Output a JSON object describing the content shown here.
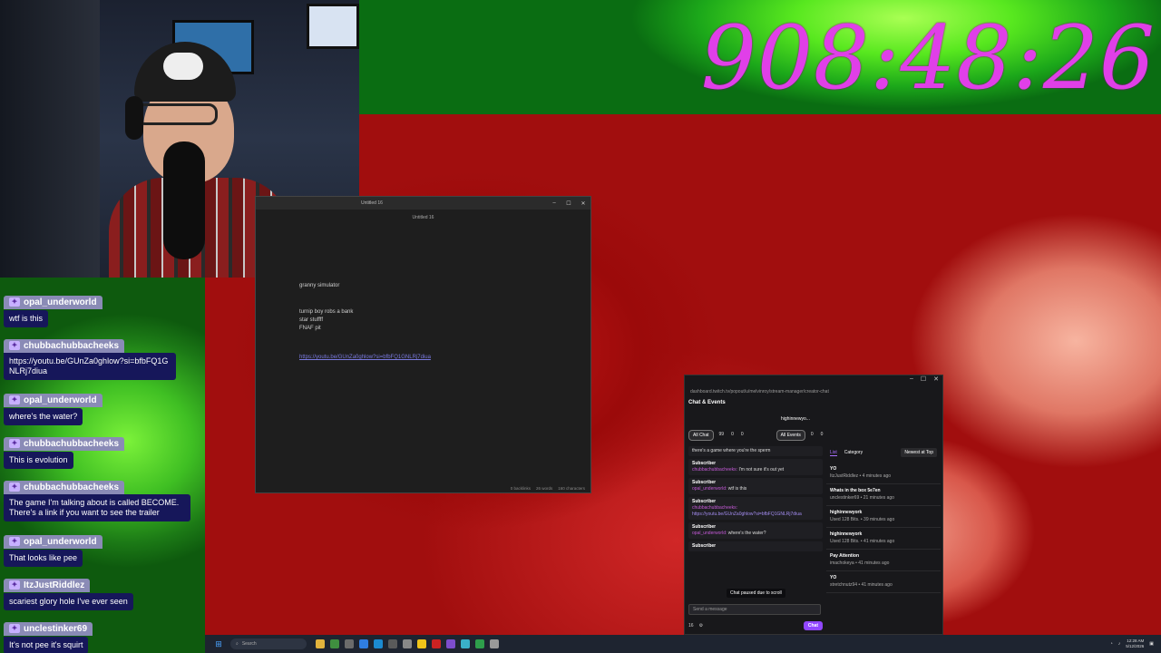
{
  "timer": {
    "text": "908:48:26"
  },
  "chat_overlay": {
    "messages": [
      {
        "user": "opal_underworld",
        "text": "wtf is this"
      },
      {
        "user": "chubbachubbacheeks",
        "text": "https://youtu.be/GUnZa0ghlow?si=bfbFQ1GNLRj7diua"
      },
      {
        "user": "opal_underworld",
        "text": "where's the water?"
      },
      {
        "user": "chubbachubbacheeks",
        "text": "This is evolution"
      },
      {
        "user": "chubbachubbacheeks",
        "text": "The game I'm talking about is called BECOME. There's a link if you want to see the trailer"
      },
      {
        "user": "opal_underworld",
        "text": "That looks like pee"
      },
      {
        "user": "ItzJustRiddlez",
        "text": "scariest glory hole I've ever seen"
      },
      {
        "user": "unclestinker69",
        "text": "It's not pee it's squirt"
      }
    ]
  },
  "notepad": {
    "tab_title": "Untitled 16",
    "doc_title": "Untitled 16",
    "lines": [
      "granny simulator",
      "turnip boy robs a bank",
      "star stuffff",
      "FNAF pit"
    ],
    "link": "https://youtu.be/GUnZa0ghlow?si=bfbFQ1GNLRj7diua",
    "footer": {
      "backlinks": "0 backlinks",
      "words": "26 words",
      "characters": "160 characters"
    }
  },
  "twitch": {
    "url": "dashboard.twitch.tv/popout/u/melvinroy/stream-manager/creator-chat",
    "header": "Chat & Events",
    "channel": "highinnewyo...",
    "tabs": {
      "all_chat": "All Chat",
      "count1": "99",
      "count2": "0",
      "count3": "0",
      "all_events": "All Events",
      "count4": "0",
      "count5": "0"
    },
    "chat": [
      {
        "kind": "partial",
        "text": "there's a game where you're the sperm"
      },
      {
        "kind": "sub",
        "badge": "Subscriber",
        "user": "chubbachubbacheeks:",
        "text": "I'm not sure it's out yet"
      },
      {
        "kind": "sub",
        "badge": "Subscriber",
        "user": "opal_underworld:",
        "text": "wtf is this"
      },
      {
        "kind": "sub",
        "badge": "Subscriber",
        "user": "chubbachubbacheeks:",
        "text": "https://youtu.be/GUnZa0ghlow?si=bfbFQ1GNLRj7diua"
      },
      {
        "kind": "sub",
        "badge": "Subscriber",
        "user": "opal_underworld:",
        "text": "where's the water?"
      },
      {
        "kind": "sub",
        "badge": "Subscriber",
        "user": "",
        "text": ""
      }
    ],
    "paused": "Chat paused due to scroll",
    "input_placeholder": "Send a message",
    "viewers": "16",
    "chat_button": "Chat",
    "events_header": {
      "list": "List",
      "category": "Category",
      "sort": "Newest at Top"
    },
    "events": [
      {
        "title": "YO",
        "meta": "ItzJustRiddlez • 4 minutes ago"
      },
      {
        "title": "Whats in the box 5e7en",
        "meta": "unclestinker69 • 21 minutes ago"
      },
      {
        "title": "highinnewyork",
        "meta": "Used 128 Bits. • 39 minutes ago"
      },
      {
        "title": "highinnewyork",
        "meta": "Used 128 Bits. • 41 minutes ago"
      },
      {
        "title": "Pay Attention",
        "meta": "imachokeya • 41 minutes ago"
      },
      {
        "title": "YO",
        "meta": "stretchnutz94 • 41 minutes ago"
      }
    ]
  },
  "taskbar": {
    "search": "Search",
    "time": "12:28 AM",
    "date": "5/12/2026"
  }
}
